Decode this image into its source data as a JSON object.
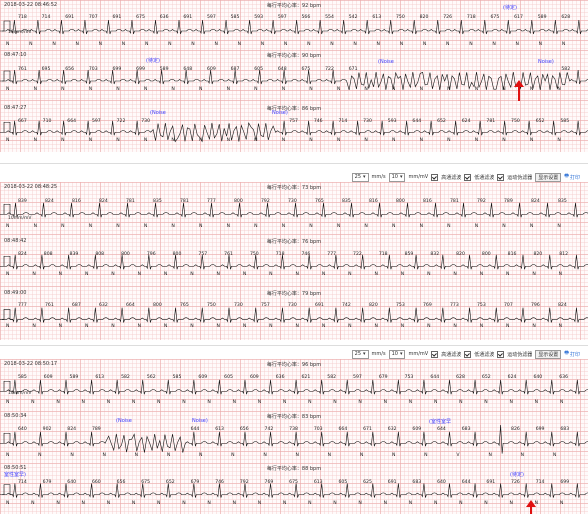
{
  "panels": [
    {
      "strips": [
        {
          "timestamp": "2018-03-22 08:46:52",
          "avg": "每行平均心率：92 bpm",
          "intervals": [
            "718",
            "714",
            "691",
            "707",
            "691",
            "675",
            "636",
            "691",
            "597",
            "585",
            "593",
            "597",
            "566",
            "554",
            "542",
            "613",
            "750",
            "820",
            "726",
            "718",
            "675",
            "617",
            "589",
            "628"
          ],
          "labels": [
            "N",
            "N",
            "N",
            "N",
            "N",
            "N",
            "N",
            "N",
            "N",
            "N",
            "N",
            "N",
            "N",
            "N",
            "N",
            "N",
            "N",
            "N",
            "N",
            "N",
            "N",
            "N",
            "N",
            "N",
            "N"
          ],
          "marks": [
            "(待定)"
          ]
        },
        {
          "timestamp": "08:47:10",
          "avg": "每行平均心率：90 bpm",
          "intervals": [
            "761",
            "695",
            "656",
            "703",
            "699",
            "699",
            "589",
            "648",
            "609",
            "687",
            "605",
            "648",
            "675",
            "722",
            "671",
            "",
            "",
            "",
            "",
            "",
            "",
            "",
            "",
            "582"
          ],
          "labels": [
            "N",
            "N",
            "N",
            "N",
            "N",
            "N",
            "N",
            "N",
            "N",
            "N",
            "N",
            "N",
            "N",
            "N",
            "N",
            "N",
            "N",
            "N",
            "N",
            "N",
            "N"
          ],
          "marks": [
            "(待定)",
            "(Noise",
            "Noise)"
          ]
        },
        {
          "timestamp": "08:47:27",
          "avg": "每行平均心率：86 bpm",
          "intervals": [
            "667",
            "710",
            "664",
            "597",
            "722",
            "730",
            "",
            "",
            "",
            "",
            "",
            "757",
            "746",
            "714",
            "730",
            "593",
            "644",
            "652",
            "624",
            "781",
            "750",
            "652",
            "585"
          ],
          "labels": [
            "N",
            "N",
            "N",
            "N",
            "N",
            "N",
            "N",
            "N",
            "N",
            "N",
            "N",
            "N",
            "N",
            "N",
            "N",
            "N",
            "N",
            "N",
            "N",
            "N",
            "N"
          ],
          "marks": [
            "(Noise",
            "Noise)"
          ]
        }
      ]
    },
    {
      "toolbar": {
        "speed": "25",
        "speed_unit": "mm/s",
        "gain": "10",
        "gain_unit": "mm/mV",
        "f1": "高通滤波",
        "f2": "低通滤波",
        "f3": "运动伪滤器",
        "settings": "显示设置",
        "print": "打印"
      },
      "strips": [
        {
          "timestamp": "2018-03-22 08:48:25",
          "avg": "每行平均心率：73 bpm",
          "intervals": [
            "839",
            "824",
            "816",
            "824",
            "781",
            "835",
            "781",
            "777",
            "800",
            "792",
            "730",
            "765",
            "835",
            "816",
            "800",
            "816",
            "781",
            "792",
            "789",
            "824",
            "835"
          ],
          "labels": [
            "N",
            "N",
            "N",
            "N",
            "N",
            "N",
            "N",
            "N",
            "N",
            "N",
            "N",
            "N",
            "N",
            "N",
            "N",
            "N",
            "N",
            "N",
            "N",
            "N",
            "N"
          ],
          "marks": []
        },
        {
          "timestamp": "08:48:42",
          "avg": "每行平均心率：76 bpm",
          "intervals": [
            "824",
            "808",
            "839",
            "808",
            "800",
            "796",
            "800",
            "757",
            "761",
            "750",
            "718",
            "746",
            "777",
            "722",
            "718",
            "859",
            "832",
            "820",
            "800",
            "816",
            "820",
            "812"
          ],
          "labels": [
            "N",
            "N",
            "N",
            "N",
            "N",
            "N",
            "N",
            "N",
            "N",
            "N",
            "N",
            "N",
            "N",
            "N",
            "N",
            "N",
            "N",
            "N",
            "N",
            "N",
            "N",
            "N"
          ],
          "marks": []
        },
        {
          "timestamp": "08:49:00",
          "avg": "每行平均心率：79 bpm",
          "intervals": [
            "777",
            "761",
            "687",
            "632",
            "664",
            "800",
            "765",
            "750",
            "730",
            "757",
            "730",
            "691",
            "742",
            "820",
            "753",
            "769",
            "773",
            "753",
            "707",
            "796",
            "824"
          ],
          "labels": [
            "N",
            "N",
            "N",
            "N",
            "N",
            "N",
            "N",
            "N",
            "N",
            "N",
            "N",
            "N",
            "N",
            "N",
            "N",
            "N",
            "N",
            "N",
            "N",
            "N",
            "N",
            "N"
          ],
          "marks": []
        }
      ]
    },
    {
      "toolbar": {
        "speed": "25",
        "speed_unit": "mm/s",
        "gain": "10",
        "gain_unit": "mm/mV",
        "f1": "高通滤波",
        "f2": "低通滤波",
        "f3": "运动伪滤器",
        "settings": "显示设置",
        "print": "打印"
      },
      "strips": [
        {
          "timestamp": "2018-03-22 08:50:17",
          "avg": "每行平均心率：96 bpm",
          "intervals": [
            "585",
            "609",
            "589",
            "613",
            "582",
            "562",
            "585",
            "609",
            "605",
            "609",
            "636",
            "621",
            "582",
            "597",
            "679",
            "753",
            "644",
            "628",
            "652",
            "624",
            "640",
            "636"
          ],
          "labels": [
            "N",
            "N",
            "N",
            "N",
            "N",
            "N",
            "N",
            "N",
            "N",
            "N",
            "N",
            "N",
            "N",
            "N",
            "N",
            "N",
            "N",
            "N",
            "N",
            "N",
            "N",
            "N",
            "N"
          ],
          "marks": []
        },
        {
          "timestamp": "08:50:34",
          "avg": "每行平均心率：83 bpm",
          "intervals": [
            "640",
            "902",
            "824",
            "789",
            "",
            "",
            "",
            "644",
            "613",
            "656",
            "742",
            "738",
            "703",
            "664",
            "671",
            "632",
            "609",
            "644",
            "683",
            "",
            "826",
            "699",
            "683"
          ],
          "labels": [
            "N",
            "N",
            "N",
            "N",
            "N",
            "N",
            "N",
            "N",
            "N",
            "N",
            "N",
            "N",
            "N",
            "N",
            "V",
            "N",
            "N",
            "N"
          ],
          "marks": [
            "(Noise",
            "Noise)",
            "(室性室早"
          ]
        },
        {
          "timestamp": "08:50:51",
          "avg": "每行平均心率：88 bpm",
          "intervals": [
            "714",
            "679",
            "640",
            "660",
            "656",
            "675",
            "652",
            "679",
            "746",
            "792",
            "769",
            "675",
            "613",
            "605",
            "625",
            "691",
            "683",
            "640",
            "644",
            "691",
            "726",
            "714",
            "699"
          ],
          "labels": [
            "N",
            "N",
            "N",
            "N",
            "N",
            "N",
            "N",
            "N",
            "N",
            "N",
            "N",
            "N",
            "N",
            "N",
            "N",
            "N",
            "N",
            "N",
            "N",
            "N",
            "N",
            "N",
            "N"
          ],
          "marks": [
            "室性室早)",
            "(待定)"
          ]
        }
      ]
    }
  ],
  "scale_label": "10mm/mV"
}
